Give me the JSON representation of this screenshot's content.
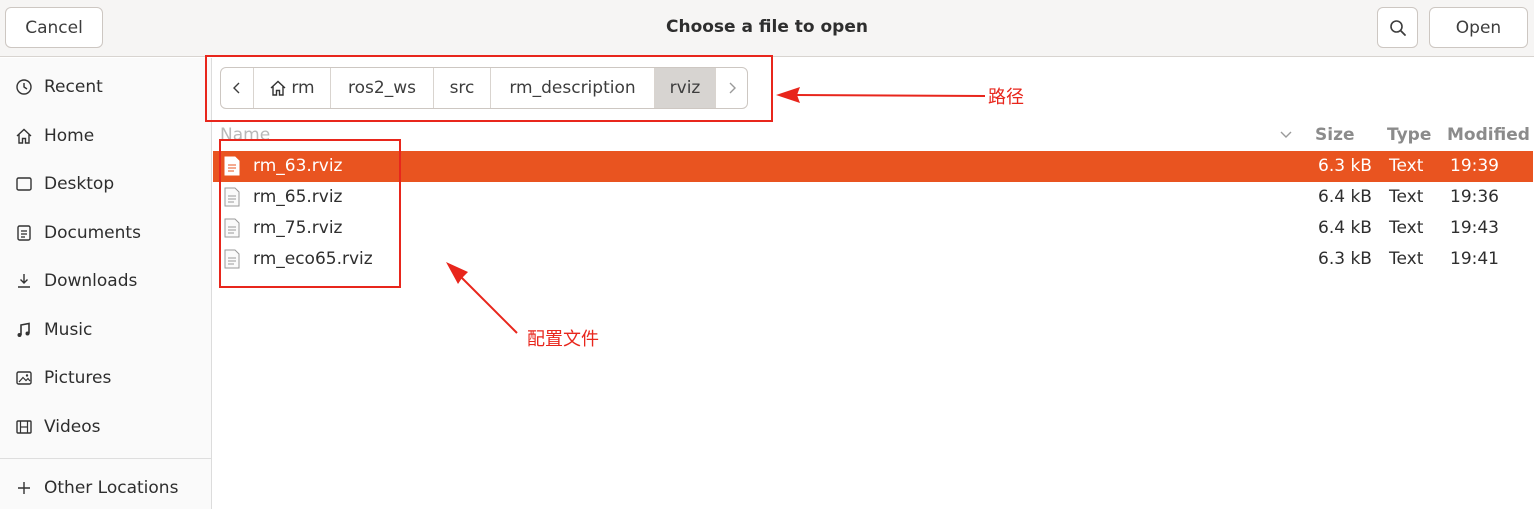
{
  "header": {
    "title": "Choose a file to open",
    "cancel_label": "Cancel",
    "open_label": "Open"
  },
  "sidebar": {
    "items": [
      {
        "label": "Recent",
        "icon": "clock-icon"
      },
      {
        "label": "Home",
        "icon": "home-icon"
      },
      {
        "label": "Desktop",
        "icon": "desktop-icon"
      },
      {
        "label": "Documents",
        "icon": "document-icon"
      },
      {
        "label": "Downloads",
        "icon": "download-icon"
      },
      {
        "label": "Music",
        "icon": "music-icon"
      },
      {
        "label": "Pictures",
        "icon": "picture-icon"
      },
      {
        "label": "Videos",
        "icon": "video-icon"
      }
    ],
    "other_locations": {
      "label": "Other Locations",
      "icon": "plus-icon"
    }
  },
  "pathbar": {
    "crumbs": [
      "rm",
      "ros2_ws",
      "src",
      "rm_description",
      "rviz"
    ],
    "active": "rviz"
  },
  "columns": {
    "name": "Name",
    "size": "Size",
    "type": "Type",
    "modified": "Modified"
  },
  "files": [
    {
      "name": "rm_63.rviz",
      "size": "6.3 kB",
      "type": "Text",
      "modified": "19:39",
      "selected": true
    },
    {
      "name": "rm_65.rviz",
      "size": "6.4 kB",
      "type": "Text",
      "modified": "19:36",
      "selected": false
    },
    {
      "name": "rm_75.rviz",
      "size": "6.4 kB",
      "type": "Text",
      "modified": "19:43",
      "selected": false
    },
    {
      "name": "rm_eco65.rviz",
      "size": "6.3 kB",
      "type": "Text",
      "modified": "19:41",
      "selected": false
    }
  ],
  "annotations": {
    "path_label": "路径",
    "files_label": "配置文件",
    "color": "#e8261c"
  },
  "colors": {
    "accent": "#e95420"
  }
}
